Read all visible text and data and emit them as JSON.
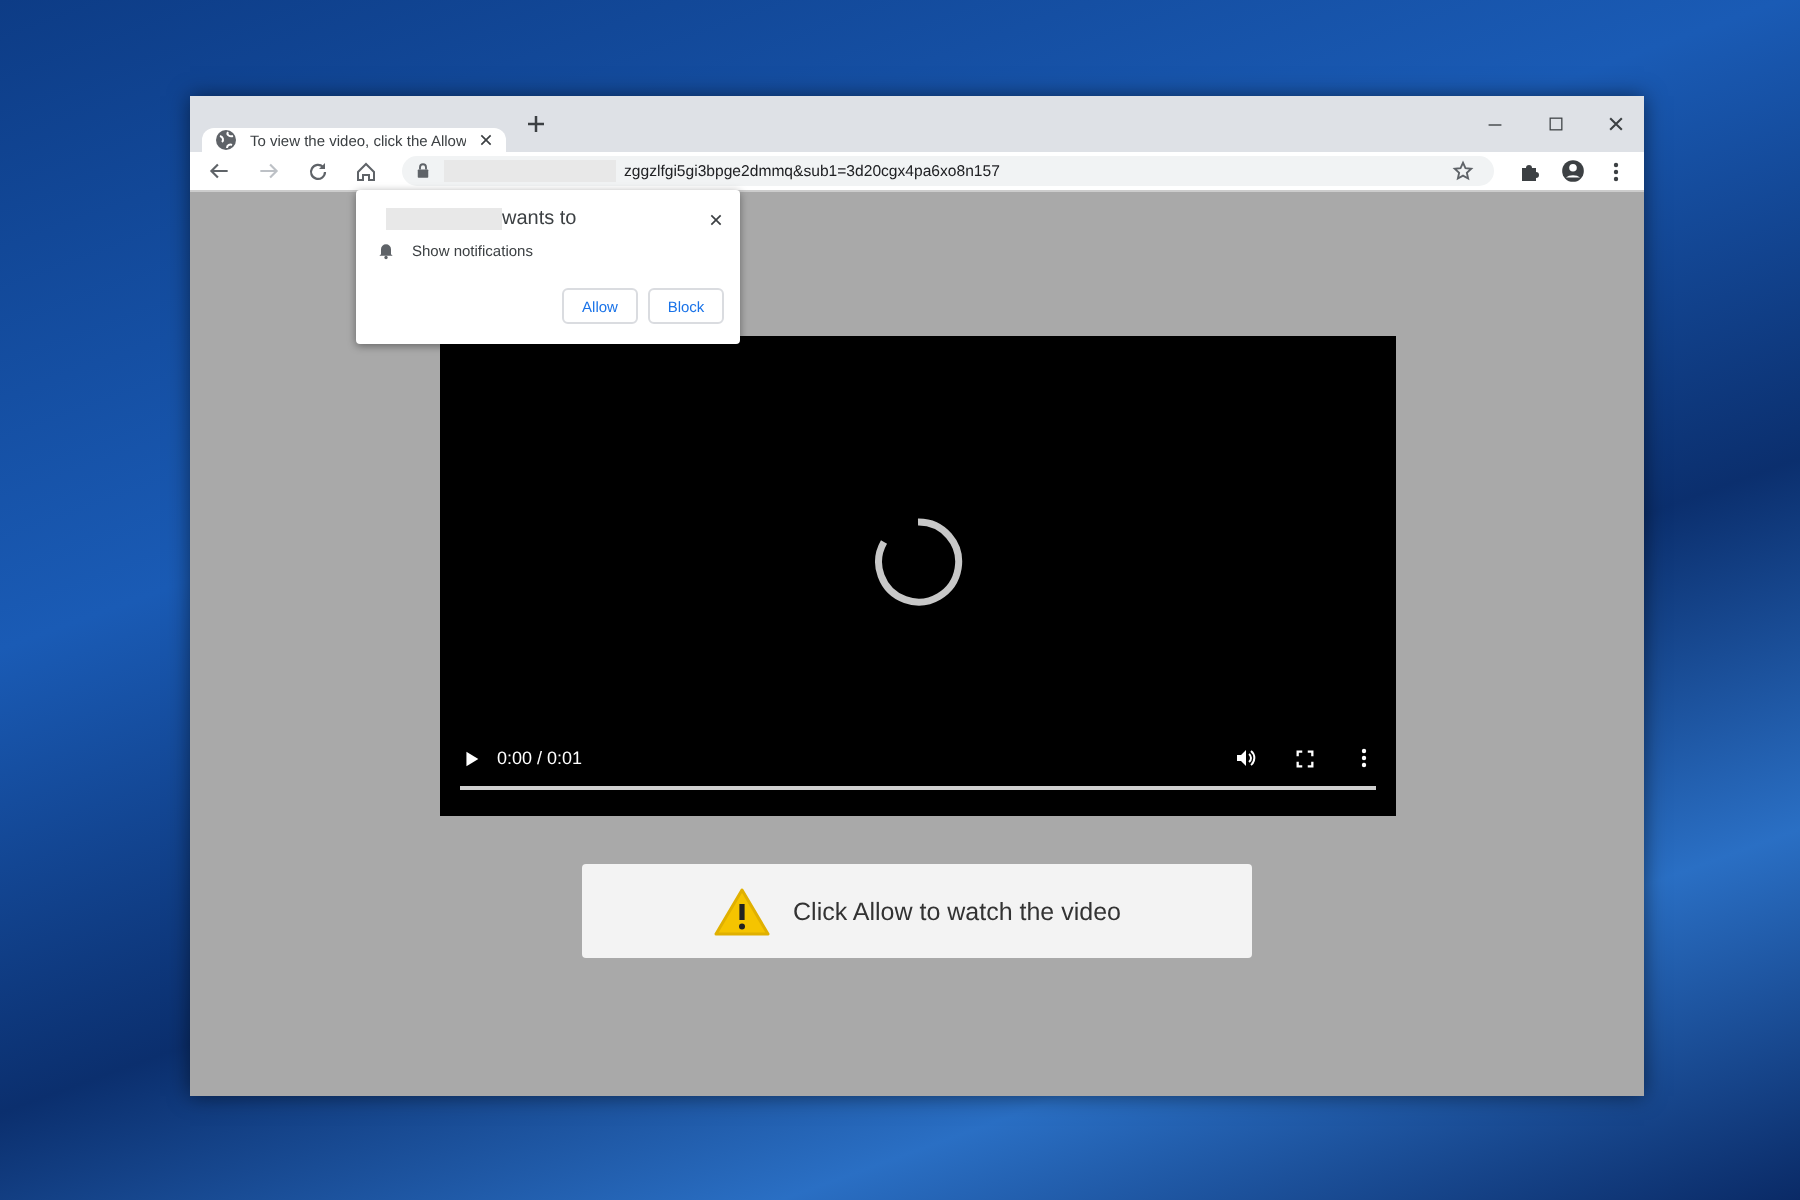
{
  "tab": {
    "title": "To view the video, click the Allow"
  },
  "address_bar": {
    "url": "zggzlfgi5gi3bpge2dmmq&sub1=3d20cgx4pa6xo8n157"
  },
  "permission_popup": {
    "message": "wants to",
    "permission": "Show notifications",
    "buttons": [
      {
        "label": "Allow"
      },
      {
        "label": "Block"
      }
    ]
  },
  "video": {
    "time": "0:00 / 0:01"
  },
  "notice": {
    "text": "Click Allow to watch the video"
  }
}
